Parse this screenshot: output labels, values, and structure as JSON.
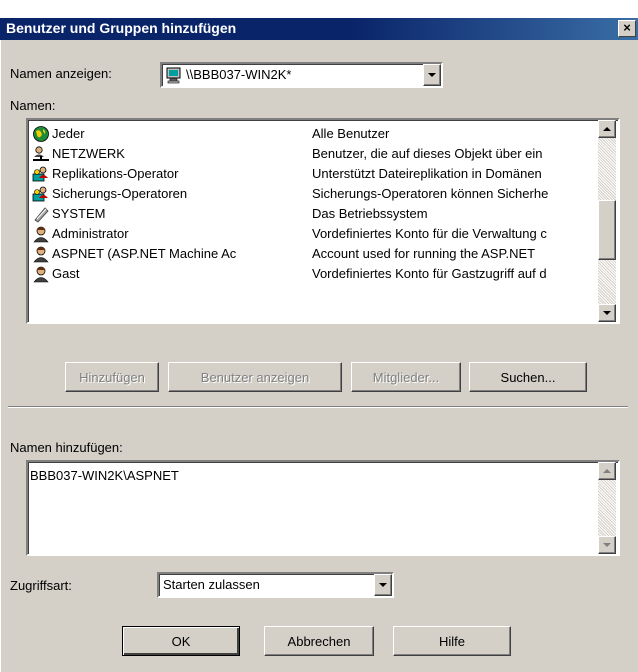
{
  "window": {
    "title": "Benutzer und Gruppen hinzufügen",
    "close_glyph": "×"
  },
  "show_names": {
    "label": "Namen anzeigen:",
    "selected": "\\\\BBB037-WIN2K*"
  },
  "names_list": {
    "label": "Namen:",
    "items": [
      {
        "name": "Jeder",
        "description": "Alle Benutzer",
        "icon": "globe-icon"
      },
      {
        "name": "NETZWERK",
        "description": "Benutzer, die auf dieses Objekt über ein",
        "icon": "network-user-icon"
      },
      {
        "name": "Replikations-Operator",
        "description": "Unterstützt Dateireplikation in Domänen",
        "icon": "group-icon"
      },
      {
        "name": "Sicherungs-Operatoren",
        "description": "Sicherungs-Operatoren können Sicherhe",
        "icon": "group-icon"
      },
      {
        "name": "SYSTEM",
        "description": "Das Betriebssystem",
        "icon": "system-icon"
      },
      {
        "name": "Administrator",
        "description": "Vordefiniertes Konto für die Verwaltung c",
        "icon": "user-icon"
      },
      {
        "name": "ASPNET (ASP.NET Machine Ac",
        "description": "Account used for running the ASP.NET",
        "icon": "user-icon"
      },
      {
        "name": "Gast",
        "description": "Vordefiniertes Konto für Gastzugriff auf d",
        "icon": "user-icon"
      }
    ]
  },
  "buttons": {
    "add": "Hinzufügen",
    "show_users": "Benutzer anzeigen",
    "members": "Mitglieder...",
    "search": "Suchen..."
  },
  "add_names": {
    "label": "Namen hinzufügen:",
    "value": "BBB037-WIN2K\\ASPNET"
  },
  "access_type": {
    "label": "Zugriffsart:",
    "selected": "Starten zulassen"
  },
  "footer": {
    "ok": "OK",
    "cancel": "Abbrechen",
    "help": "Hilfe"
  },
  "colors": {
    "titlebar": "#0a246a",
    "face": "#d4d0c8"
  }
}
